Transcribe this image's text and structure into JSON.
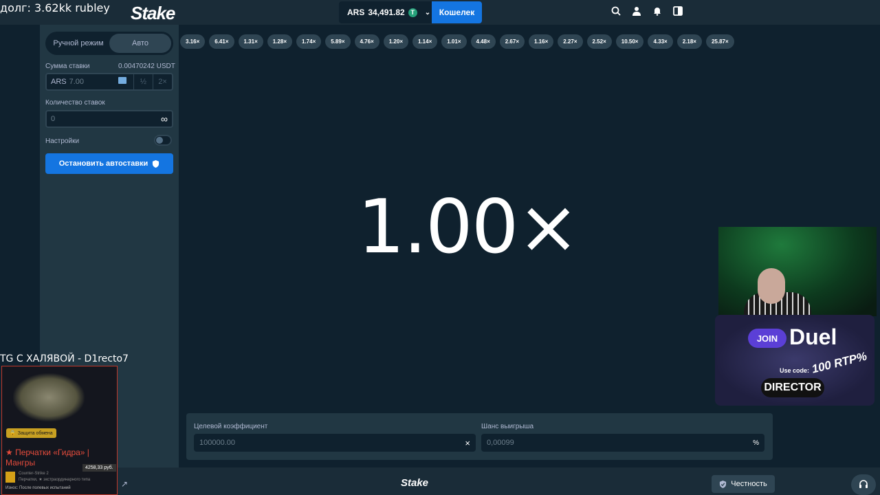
{
  "overlay": {
    "debt_text": "долг: 3.62kk rubley",
    "tg_text": "TG С ХАЛЯВОЙ - D1recto7",
    "card": {
      "badge": "Защита обмена",
      "title": "★ Перчатки «Гидра» | Мангры",
      "price": "4258,33 руб.",
      "game": "Counter-Strike 2",
      "subtitle": "Перчатки, ★ экстраординарного типа",
      "wear": "Износ: После полевых испытаний"
    },
    "promo": {
      "join": "JOIN",
      "brand": "Duel",
      "rtp": "100 RTP%",
      "use_code": "Use code:",
      "code": "DIRECTOR"
    }
  },
  "header": {
    "logo": "Stake",
    "currency": "ARS",
    "balance": "34,491.82",
    "coin_symbol": "T",
    "wallet_label": "Кошелек",
    "icons": [
      "search-icon",
      "user-icon",
      "bell-icon",
      "sidebar-toggle-icon"
    ]
  },
  "sidebar": {
    "mode_manual": "Ручной режим",
    "mode_auto": "Авто",
    "bet_amount_label": "Сумма ставки",
    "bet_amount_usd": "0.00470242 USDT",
    "bet_currency": "ARS",
    "bet_value": "7.00",
    "half_label": "½",
    "double_label": "2×",
    "bets_count_label": "Количество ставок",
    "bets_count_value": "0",
    "infinity_symbol": "∞",
    "settings_label": "Настройки",
    "stop_button": "Остановить автоставки"
  },
  "game": {
    "history": [
      "3.16×",
      "6.41×",
      "1.31×",
      "1.28×",
      "1.74×",
      "5.89×",
      "4.76×",
      "1.20×",
      "1.14×",
      "1.01×",
      "4.48×",
      "2.67×",
      "1.16×",
      "2.27×",
      "2.52×",
      "10.50×",
      "4.33×",
      "2.18×",
      "25.87×"
    ],
    "multiplier": "1.00×",
    "target_label": "Целевой коэффициент",
    "target_value": "100000.00",
    "target_suffix": "×",
    "chance_label": "Шанс выигрыша",
    "chance_value": "0,00099",
    "chance_suffix": "%"
  },
  "footer": {
    "logo": "Stake",
    "fairness": "Честность"
  },
  "colors": {
    "accent": "#1475e1",
    "bg": "#0f212e",
    "panel": "#213743"
  }
}
